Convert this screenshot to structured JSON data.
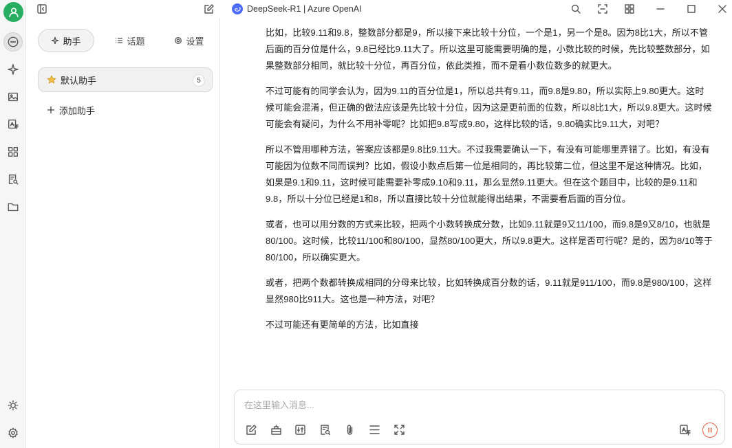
{
  "window": {
    "title": "DeepSeek-R1 | Azure OpenAI"
  },
  "sidebar": {
    "tabs": [
      {
        "label": "助手",
        "icon": "sparkle-icon"
      },
      {
        "label": "话题",
        "icon": "list-icon"
      },
      {
        "label": "设置",
        "icon": "gear-icon"
      }
    ],
    "agents": [
      {
        "label": "默认助手",
        "count": "5",
        "icon": "star-icon"
      }
    ],
    "add_label": "添加助手"
  },
  "message": {
    "paragraphs": [
      "比如，比较9.11和9.8，整数部分都是9，所以接下来比较十分位，一个是1，另一个是8。因为8比1大，所以不管后面的百分位是什么，9.8已经比9.11大了。所以这里可能需要明确的是，小数比较的时候，先比较整数部分，如果整数部分相同，就比较十分位，再百分位，依此类推，而不是看小数位数多的就更大。",
      "不过可能有的同学会认为，因为9.11的百分位是1，所以总共有9.11，而9.8是9.80，所以实际上9.80更大。这时候可能会混淆，但正确的做法应该是先比较十分位，因为这是更前面的位数，所以8比1大，所以9.8更大。这时候可能会有疑问，为什么不用补零呢？比如把9.8写成9.80，这样比较的话，9.80确实比9.11大，对吧？",
      "所以不管用哪种方法，答案应该都是9.8比9.11大。不过我需要确认一下，有没有可能哪里弄错了。比如，有没有可能因为位数不同而误判？比如，假设小数点后第一位是相同的，再比较第二位，但这里不是这种情况。比如，如果是9.1和9.11，这时候可能需要补零成9.10和9.11，那么显然9.11更大。但在这个题目中，比较的是9.11和9.8，所以十分位已经是1和8，所以直接比较十分位就能得出结果，不需要看后面的百分位。",
      "或者，也可以用分数的方式来比较，把两个小数转换成分数，比如9.11就是9又11/100，而9.8是9又8/10，也就是80/100。这时候，比较11/100和80/100，显然80/100更大，所以9.8更大。这样是否可行呢？是的，因为8/10等于80/100，所以确实更大。",
      "或者，把两个数都转换成相同的分母来比较，比如转换成百分数的话，9.11就是911/100，而9.8是980/100，这样显然980比911大。这也是一种方法，对吧？",
      "不过可能还有更简单的方法，比如直接"
    ]
  },
  "input": {
    "placeholder": "在这里输入消息..."
  },
  "colors": {
    "avatar": "#27ae60",
    "logo": "#4d6bfe",
    "pause": "#e35d3a"
  }
}
